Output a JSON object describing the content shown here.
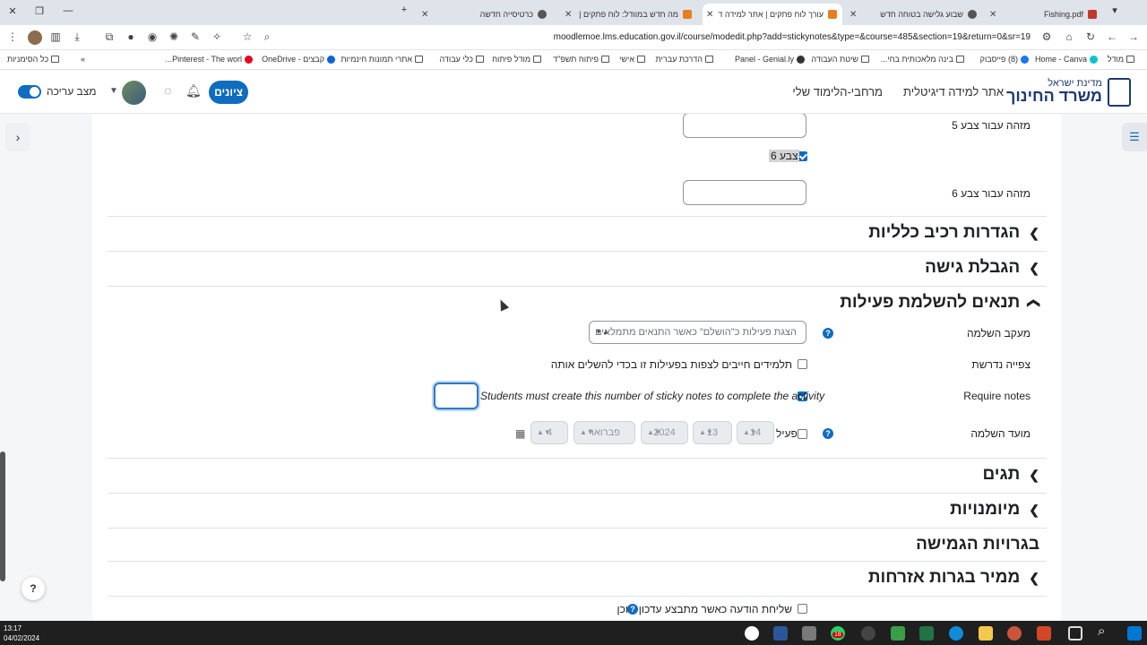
{
  "tabs": [
    {
      "title": "Fishing.pdf",
      "fav": "#c0392b"
    },
    {
      "title": "שבוע גלישה בטוחה חדש",
      "fav": "#555"
    },
    {
      "title": "עורך לוח פתקים | אתר למידה ד",
      "fav": "#e67e22",
      "active": true
    },
    {
      "title": "מה חדש במוודל: לוח פתקים |",
      "fav": "#e67e22"
    },
    {
      "title": "כרטיסייה חדשה",
      "fav": "#555"
    }
  ],
  "address": {
    "url": "moodlemoe.lms.education.gov.il/course/modedit.php?add=stickynotes&type=&course=485&section=19&return=0&sr=19"
  },
  "bookmarks": [
    {
      "label": "מודל",
      "kind": "folder"
    },
    {
      "label": "Home - Canva",
      "kind": "dot",
      "color": "#00c4cc"
    },
    {
      "label": "(8) פייסבוק",
      "kind": "dot",
      "color": "#1877f2"
    },
    {
      "label": "בינה מלאכותית בחי...",
      "kind": "folder"
    },
    {
      "label": "שיטת העבודה",
      "kind": "folder"
    },
    {
      "label": "Panel - Genial.ly",
      "kind": "dot",
      "color": "#333"
    },
    {
      "label": "הדרכת עברית",
      "kind": "folder"
    },
    {
      "label": "אישי",
      "kind": "folder"
    },
    {
      "label": "פיתוח תשפ\"ד",
      "kind": "folder"
    },
    {
      "label": "מודל פיתוח",
      "kind": "folder"
    },
    {
      "label": "כלי עבודה",
      "kind": "folder"
    },
    {
      "label": "אתרי תמונות חינמיות",
      "kind": "folder"
    },
    {
      "label": "קבצים - OneDrive",
      "kind": "dot",
      "color": "#0a64d6"
    },
    {
      "label": "Pinterest - The worl...",
      "kind": "dot",
      "color": "#e60023"
    },
    {
      "label": "כל הסימניות",
      "kind": "folder"
    }
  ],
  "header": {
    "ministry_small": "מדינת ישראל",
    "ministry_big": "משרד החינוך",
    "nav_site": "אתר למידה דיגיטלית",
    "nav_my": "מרחבי-הלימוד שלי",
    "grades": "ציונים",
    "edit_mode": "מצב עריכה"
  },
  "form": {
    "color5_label": "מזהה עבור צבע 5",
    "color6_checkbox": "צבע 6",
    "color6_label": "מזהה עבור צבע 6",
    "sections": {
      "general": "הגדרות רכיב כלליות",
      "restrict": "הגבלת גישה",
      "completion": "תנאים להשלמת פעילות",
      "tags": "תגים",
      "competencies": "מיומנויות",
      "flex_maturity": "בגרויות הגמישה",
      "civics": "ממיר בגרות אזרחות"
    },
    "tracking_label": "מעקב השלמה",
    "tracking_value": "הצגת פעילות כ\"הושלם\" כאשר התנאים מתמלאים",
    "view_label": "צפייה נדרשת",
    "view_text": "תלמידים חייבים לצפות בפעילות זו בכדי להשלים אותה",
    "notes_label": "Require notes",
    "notes_text": "Students must create this number of sticky notes to complete the activity",
    "due_label": "מועד השלמה",
    "enable_text": "פעיל",
    "date": {
      "day": "4",
      "month": "פברואר",
      "year": "2024",
      "hour": "13",
      "minute": "14"
    },
    "notify_text": "שליחת הודעה כאשר מתבצע עדכון תוכן"
  },
  "taskbar": {
    "time": "13:17",
    "date": "04/02/2024",
    "whatsapp_badge": "18"
  }
}
